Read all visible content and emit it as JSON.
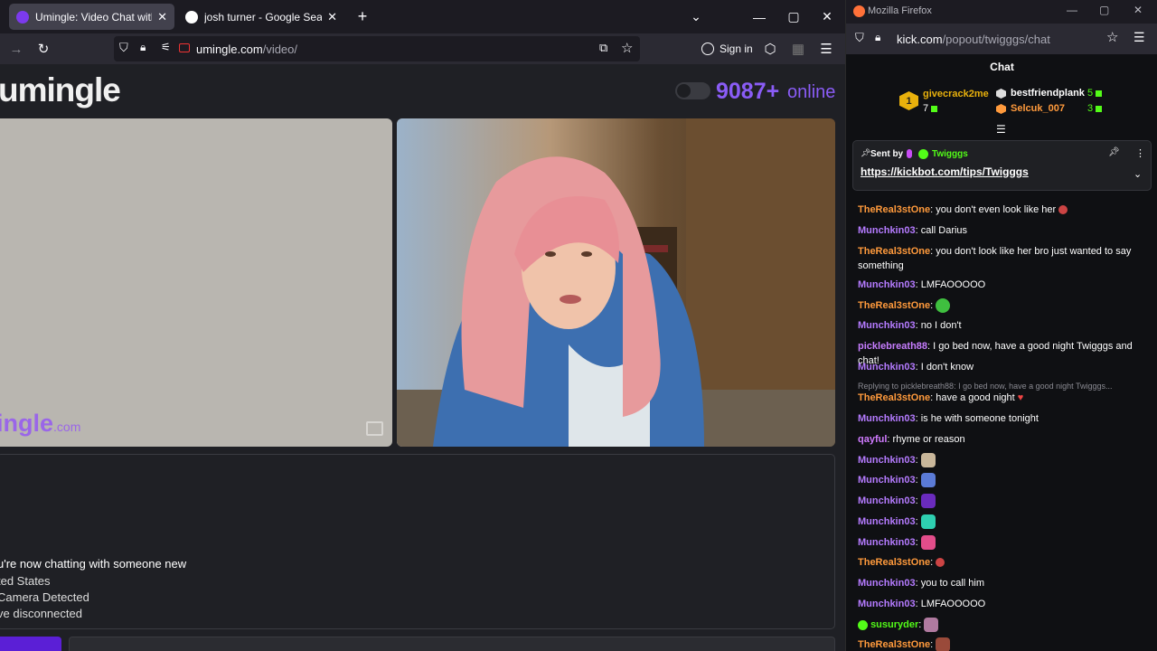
{
  "left_window": {
    "tabs": [
      {
        "title": "Umingle: Video Chat with Stran",
        "active": true,
        "favicon_color": "#7c3aed"
      },
      {
        "title": "josh turner - Google Search",
        "active": false,
        "favicon_color": "#ffffff"
      }
    ],
    "new_tab": "+",
    "url_domain": "umingle.com",
    "url_path": "/video/",
    "sign_in": "Sign in"
  },
  "page": {
    "logo": "umingle",
    "online_count": "9087+",
    "online_label": "online",
    "watermark_text": "ingle",
    "watermark_suffix": ".com",
    "chat_lines": [
      "u're now chatting with someone new",
      "ted States",
      "Camera Detected",
      "ve disconnected"
    ],
    "accent": "#8a5cf6"
  },
  "right_window": {
    "title": "Mozilla Firefox",
    "url_domain": "kick.com",
    "url_path": "/popout/twigggs/chat",
    "header": "Chat",
    "top_gifters": [
      {
        "rank": "1",
        "name": "givecrack2me",
        "count": "7",
        "color": "#e9b10c"
      },
      {
        "name": "bestfriendplank",
        "count": "5",
        "color": "#ffffff"
      },
      {
        "name": "Selcuk_007",
        "count": "3",
        "color": "#ff9a3c"
      }
    ],
    "pinned": {
      "sent_by": "Sent by",
      "user": "Twigggs",
      "link": "https://kickbot.com/tips/Twigggs"
    },
    "messages": [
      {
        "user": "TheReal3stOne",
        "color": "#ff9a3c",
        "text": "you don't even look like her"
      },
      {
        "user": "Munchkin03",
        "color": "#b57bff",
        "text": "call Darius"
      },
      {
        "user": "TheReal3stOne",
        "color": "#ff9a3c",
        "text": "you don't look like her bro just wanted to say something"
      },
      {
        "user": "Munchkin03",
        "color": "#b57bff",
        "text": "LMFAOOOOO"
      },
      {
        "user": "TheReal3stOne",
        "color": "#ff9a3c",
        "text": ""
      },
      {
        "user": "Munchkin03",
        "color": "#b57bff",
        "text": "no I don't"
      },
      {
        "user": "picklebreath88",
        "color": "#c77dff",
        "text": "I go bed now, have a good night Twigggs and chat!"
      },
      {
        "user": "Munchkin03",
        "color": "#b57bff",
        "text": "I don't know"
      },
      {
        "user": "TheReal3stOne",
        "color": "#ff9a3c",
        "text": "have a good night"
      },
      {
        "user": "Munchkin03",
        "color": "#b57bff",
        "text": "is he with someone tonight"
      },
      {
        "user": "qayful",
        "color": "#d07bff",
        "text": "rhyme or reason"
      },
      {
        "user": "Munchkin03",
        "color": "#b57bff",
        "text": ""
      },
      {
        "user": "Munchkin03",
        "color": "#b57bff",
        "text": ""
      },
      {
        "user": "Munchkin03",
        "color": "#b57bff",
        "text": ""
      },
      {
        "user": "Munchkin03",
        "color": "#b57bff",
        "text": ""
      },
      {
        "user": "Munchkin03",
        "color": "#b57bff",
        "text": ""
      },
      {
        "user": "TheReal3stOne",
        "color": "#ff9a3c",
        "text": ""
      },
      {
        "user": "Munchkin03",
        "color": "#b57bff",
        "text": "you to call him"
      },
      {
        "user": "Munchkin03",
        "color": "#b57bff",
        "text": "LMFAOOOOO"
      },
      {
        "user": "susuryder",
        "color": "#53fc18",
        "text": ""
      },
      {
        "user": "TheReal3stOne",
        "color": "#ff9a3c",
        "text": ""
      }
    ],
    "reply_context": "Replying to picklebreath88: I go bed now, have a good night Twigggs..."
  }
}
